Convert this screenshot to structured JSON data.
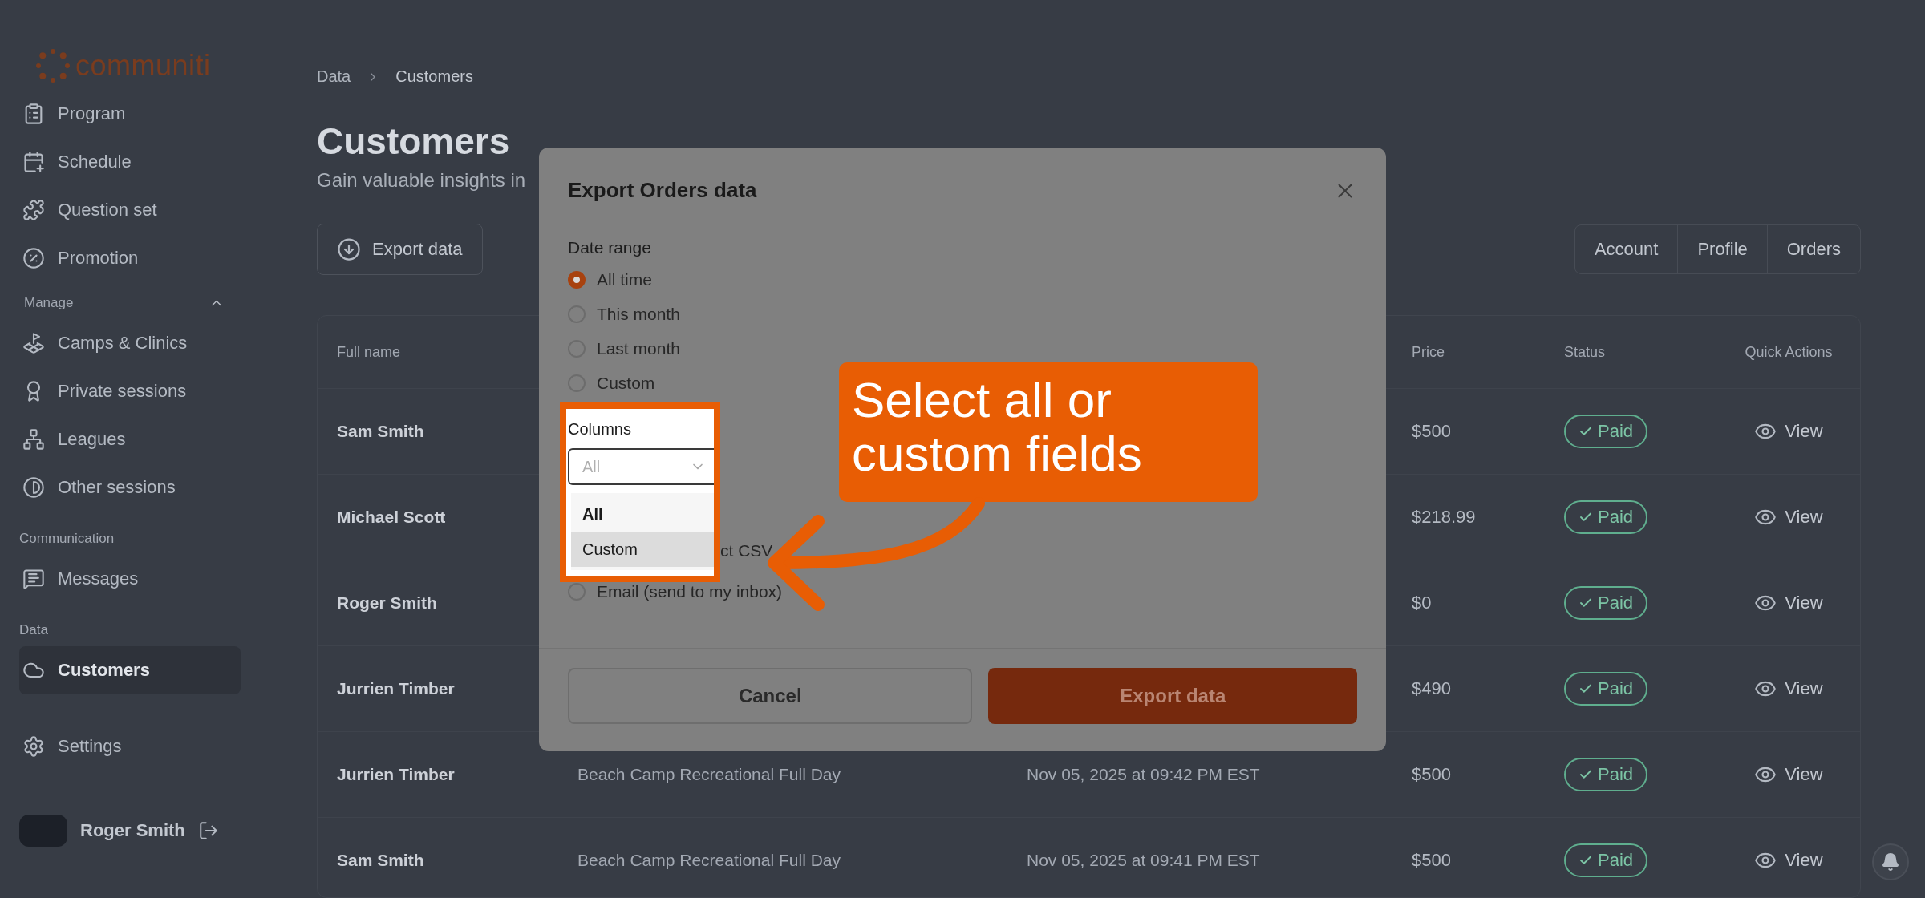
{
  "logo": {
    "text": "communiti"
  },
  "sidebar": {
    "items": [
      {
        "kind": "item",
        "label": "Program",
        "selected": false
      },
      {
        "kind": "item",
        "label": "Schedule",
        "selected": false
      },
      {
        "kind": "item",
        "label": "Question set",
        "selected": false
      },
      {
        "kind": "item",
        "label": "Promotion",
        "selected": false
      },
      {
        "kind": "heading",
        "label": "Manage",
        "expanded": true
      },
      {
        "kind": "item",
        "label": "Camps & Clinics",
        "selected": false
      },
      {
        "kind": "item",
        "label": "Private sessions",
        "selected": false
      },
      {
        "kind": "item",
        "label": "Leagues",
        "selected": false
      },
      {
        "kind": "item",
        "label": "Other sessions",
        "selected": false
      },
      {
        "kind": "heading",
        "label": "Communication"
      },
      {
        "kind": "item",
        "label": "Messages",
        "selected": false
      },
      {
        "kind": "heading",
        "label": "Data"
      },
      {
        "kind": "item",
        "label": "Customers",
        "selected": true
      }
    ],
    "footer_items": [
      {
        "label": "Settings",
        "selected": false
      }
    ],
    "user": {
      "name": "Roger Smith"
    }
  },
  "breadcrumb": [
    "Data",
    "Customers"
  ],
  "page": {
    "title": "Customers",
    "subtitle": "Gain valuable insights in"
  },
  "export_button": "Export data",
  "view_tabs": [
    {
      "label": "Account",
      "selected": false
    },
    {
      "label": "Profile",
      "selected": false
    },
    {
      "label": "Orders",
      "selected": false
    }
  ],
  "table": {
    "columns": {
      "full_name": "Full name",
      "price": "Price",
      "status": "Status",
      "quick_actions": "Quick Actions"
    },
    "rows": [
      {
        "name": "Sam Smith",
        "price": "$500",
        "status": "Paid",
        "action": "View"
      },
      {
        "name": "Michael Scott",
        "price": "$218.99",
        "status": "Paid",
        "action": "View"
      },
      {
        "name": "Roger Smith",
        "price": "$0",
        "status": "Paid",
        "action": "View"
      },
      {
        "name": "Jurrien Timber",
        "price": "$490",
        "status": "Paid",
        "action": "View"
      },
      {
        "name": "Jurrien Timber",
        "program": "Beach Camp Recreational Full Day",
        "date": "Nov 05, 2025 at 09:42 PM EST",
        "price": "$500",
        "status": "Paid",
        "action": "View"
      },
      {
        "name": "Sam Smith",
        "program": "Beach Camp Recreational Full Day",
        "date": "Nov 05, 2025 at 09:41 PM EST",
        "price": "$500",
        "status": "Paid",
        "action": "View"
      }
    ]
  },
  "modal": {
    "title": "Export Orders data",
    "date_range": {
      "label": "Date range",
      "options": [
        {
          "label": "All time",
          "selected": true
        },
        {
          "label": "This month",
          "selected": false
        },
        {
          "label": "Last month",
          "selected": false
        },
        {
          "label": "Custom",
          "selected": false
        }
      ]
    },
    "columns": {
      "label": "Columns",
      "placeholder": "All",
      "options": [
        {
          "label": "All",
          "selected": true,
          "hovered": false
        },
        {
          "label": "Custom",
          "selected": false,
          "hovered": true
        }
      ]
    },
    "delivery": [
      {
        "kind": "cut",
        "label": "ct CSV"
      },
      {
        "kind": "radio",
        "label": "Email (send to my inbox)",
        "selected": false
      }
    ],
    "cancel": "Cancel",
    "submit": "Export data"
  },
  "annotation": {
    "text": "Select all or custom fields"
  }
}
